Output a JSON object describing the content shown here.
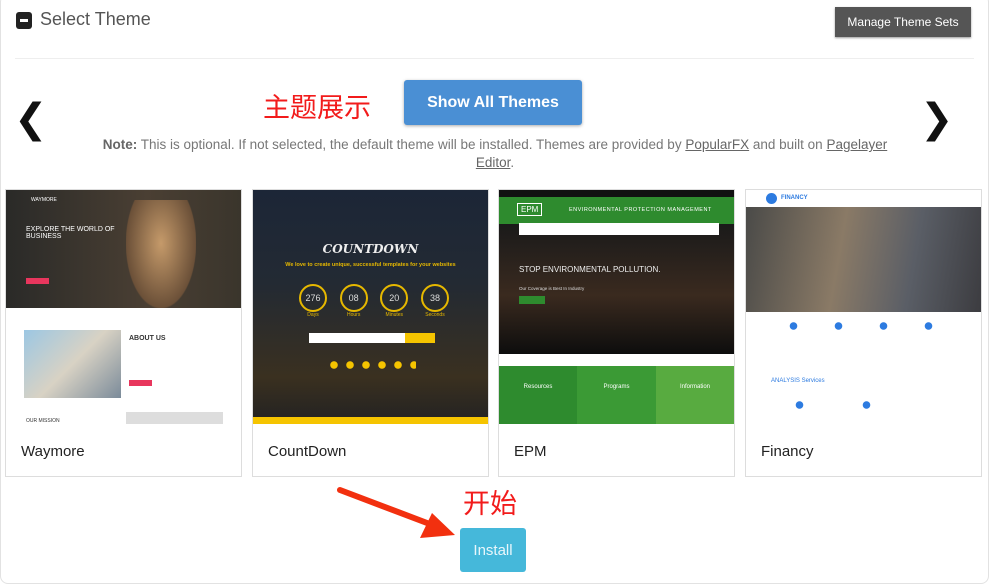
{
  "header": {
    "title": "Select Theme",
    "manage_label": "Manage Theme Sets",
    "collapse_icon": "minus-square-icon"
  },
  "carousel": {
    "prev_icon": "chevron-left-icon",
    "next_icon": "chevron-right-icon"
  },
  "annotations": {
    "theme_display": "主题展示",
    "start": "开始",
    "color": "#f21b1b"
  },
  "show_all_label": "Show All Themes",
  "note": {
    "bold": "Note:",
    "text": " This is optional. If not selected, the default theme will be installed. Themes are provided by ",
    "link1": "PopularFX",
    "mid": " and built on ",
    "link2": "Pagelayer Editor",
    "end": "."
  },
  "themes": [
    {
      "name": "Waymore",
      "preview": {
        "logo": "WAYMORE",
        "headline": "EXPLORE THE WORLD OF BUSINESS",
        "section": "ABOUT US",
        "section2": "OUR MISSION"
      }
    },
    {
      "name": "CountDown",
      "preview": {
        "title": "COUNTDOWN",
        "tagline": "We love to create unique, successful templates for your websites",
        "counters": [
          {
            "value": "276",
            "label": "Days"
          },
          {
            "value": "08",
            "label": "Hours"
          },
          {
            "value": "20",
            "label": "Minutes"
          },
          {
            "value": "38",
            "label": "Seconds"
          }
        ]
      }
    },
    {
      "name": "EPM",
      "preview": {
        "logo": "EPM",
        "banner": "ENVIRONMENTAL PROTECTION MANAGEMENT",
        "headline": "STOP ENVIRONMENTAL POLLUTION.",
        "sub": "Our Coverage is Best In Industry",
        "cols": [
          "Resources",
          "Programs",
          "Information"
        ]
      }
    },
    {
      "name": "Financy",
      "preview": {
        "logo": "FINANCY",
        "services": "ANALYSIS Services"
      }
    }
  ],
  "install_label": "Install",
  "colors": {
    "show_all": "#4a8fd4",
    "install": "#45b8da",
    "manage": "#555555"
  }
}
